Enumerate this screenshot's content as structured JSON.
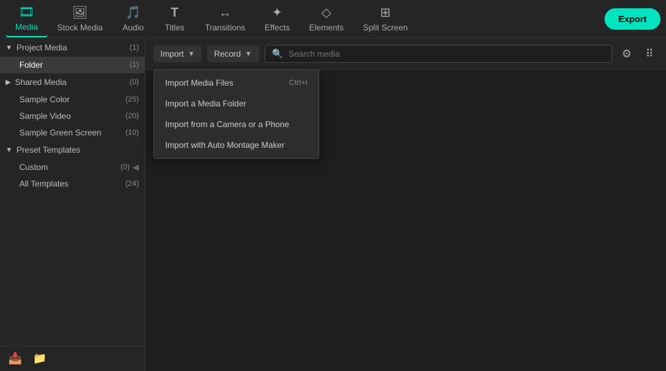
{
  "nav": {
    "items": [
      {
        "id": "media",
        "label": "Media",
        "icon": "🎞",
        "active": true
      },
      {
        "id": "stock-media",
        "label": "Stock Media",
        "icon": "🖼",
        "active": false
      },
      {
        "id": "audio",
        "label": "Audio",
        "icon": "♪",
        "active": false
      },
      {
        "id": "titles",
        "label": "Titles",
        "icon": "T",
        "active": false
      },
      {
        "id": "transitions",
        "label": "Transitions",
        "icon": "⟨⟩",
        "active": false
      },
      {
        "id": "effects",
        "label": "Effects",
        "icon": "✦",
        "active": false
      },
      {
        "id": "elements",
        "label": "Elements",
        "icon": "◇",
        "active": false
      },
      {
        "id": "split-screen",
        "label": "Split Screen",
        "icon": "⊞",
        "active": false
      }
    ],
    "export_label": "Export"
  },
  "sidebar": {
    "sections": [
      {
        "id": "project-media",
        "label": "Project Media",
        "count": "(1)",
        "expanded": true,
        "items": [
          {
            "id": "folder",
            "label": "Folder",
            "count": "(1)",
            "active": true
          }
        ]
      },
      {
        "id": "shared-media",
        "label": "Shared Media",
        "count": "(0)",
        "expanded": false,
        "items": []
      }
    ],
    "direct_items": [
      {
        "id": "sample-color",
        "label": "Sample Color",
        "count": "(25)"
      },
      {
        "id": "sample-video",
        "label": "Sample Video",
        "count": "(20)"
      },
      {
        "id": "sample-green-screen",
        "label": "Sample Green Screen",
        "count": "(10)"
      }
    ],
    "preset_templates": {
      "label": "Preset Templates",
      "expanded": true,
      "items": [
        {
          "id": "custom",
          "label": "Custom",
          "count": "(0)"
        },
        {
          "id": "all-templates",
          "label": "All Templates",
          "count": "(24)"
        }
      ]
    },
    "footer": {
      "add_icon": "+",
      "folder_icon": "📁"
    }
  },
  "toolbar": {
    "import_label": "Import",
    "record_label": "Record",
    "search_placeholder": "Search media"
  },
  "dropdown": {
    "items": [
      {
        "id": "import-media-files",
        "label": "Import Media Files",
        "shortcut": "Ctrl+I"
      },
      {
        "id": "import-media-folder",
        "label": "Import a Media Folder",
        "shortcut": ""
      },
      {
        "id": "import-camera-phone",
        "label": "Import from a Camera or a Phone",
        "shortcut": ""
      },
      {
        "id": "import-auto-montage",
        "label": "Import with Auto Montage Maker",
        "shortcut": ""
      }
    ]
  },
  "media_area": {
    "thumbs": [
      {
        "id": "thumb1",
        "icon": "⊞",
        "has_check": false
      },
      {
        "id": "thumb2",
        "icon": "✓",
        "has_check": true
      }
    ]
  }
}
